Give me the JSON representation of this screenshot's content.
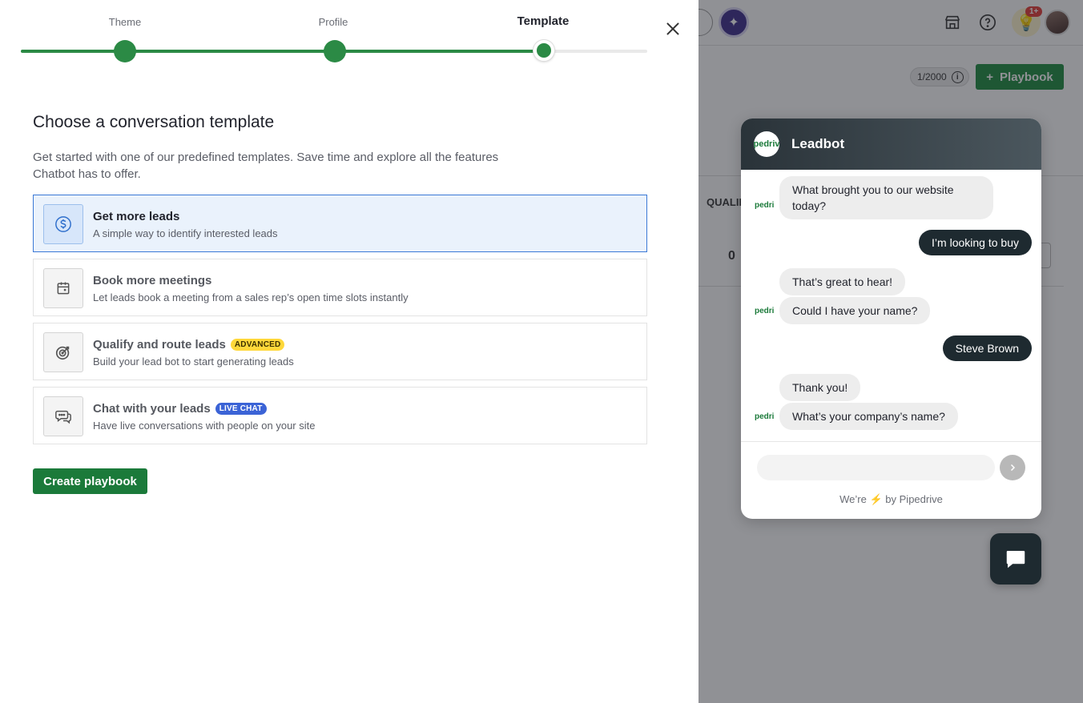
{
  "stepper": {
    "steps": [
      {
        "label": "Theme"
      },
      {
        "label": "Profile"
      },
      {
        "label": "Template"
      }
    ]
  },
  "main": {
    "title": "Choose a conversation template",
    "description": "Get started with one of our predefined templates. Save time and explore all the features Chatbot has to offer.",
    "templates": [
      {
        "title": "Get more leads",
        "subtitle": "A simple way to identify interested leads",
        "icon": "dollar-circle-icon",
        "selected": true
      },
      {
        "title": "Book more meetings",
        "subtitle": "Let leads book a meeting from a sales rep’s open time slots instantly",
        "icon": "calendar-icon"
      },
      {
        "title": "Qualify and route leads",
        "tag": "ADVANCED",
        "subtitle": "Build your lead bot to start generating leads",
        "icon": "target-icon"
      },
      {
        "title": "Chat with your leads",
        "tag": "LIVE CHAT",
        "subtitle": "Have live conversations with people on your site",
        "icon": "chat-bubbles-icon"
      }
    ],
    "create_button": "Create playbook"
  },
  "background": {
    "counter": "1/2000",
    "playbook_button": "Playbook",
    "column_header": "QUALIF",
    "cell_value": "0",
    "notification_badge": "1+"
  },
  "chat": {
    "bot_name": "Leadbot",
    "logo_text": "pedriv",
    "messages": [
      {
        "from": "bot",
        "text": "What brought you to our website today?"
      },
      {
        "from": "user",
        "text": "I’m looking to buy"
      },
      {
        "from": "bot",
        "text": "That’s great to hear!"
      },
      {
        "from": "bot",
        "text": "Could I have your name?"
      },
      {
        "from": "user",
        "text": "Steve Brown"
      },
      {
        "from": "bot",
        "text": "Thank you!"
      },
      {
        "from": "bot",
        "text": "What’s your company’s name?"
      }
    ],
    "input_placeholder": "",
    "powered_prefix": "We’re",
    "powered_suffix": "by Pipedrive"
  },
  "colors": {
    "accent_green": "#2b8a45",
    "button_green": "#1b7a3a",
    "selected_blue": "#3b79d6",
    "chat_dark": "#1e2a30"
  }
}
